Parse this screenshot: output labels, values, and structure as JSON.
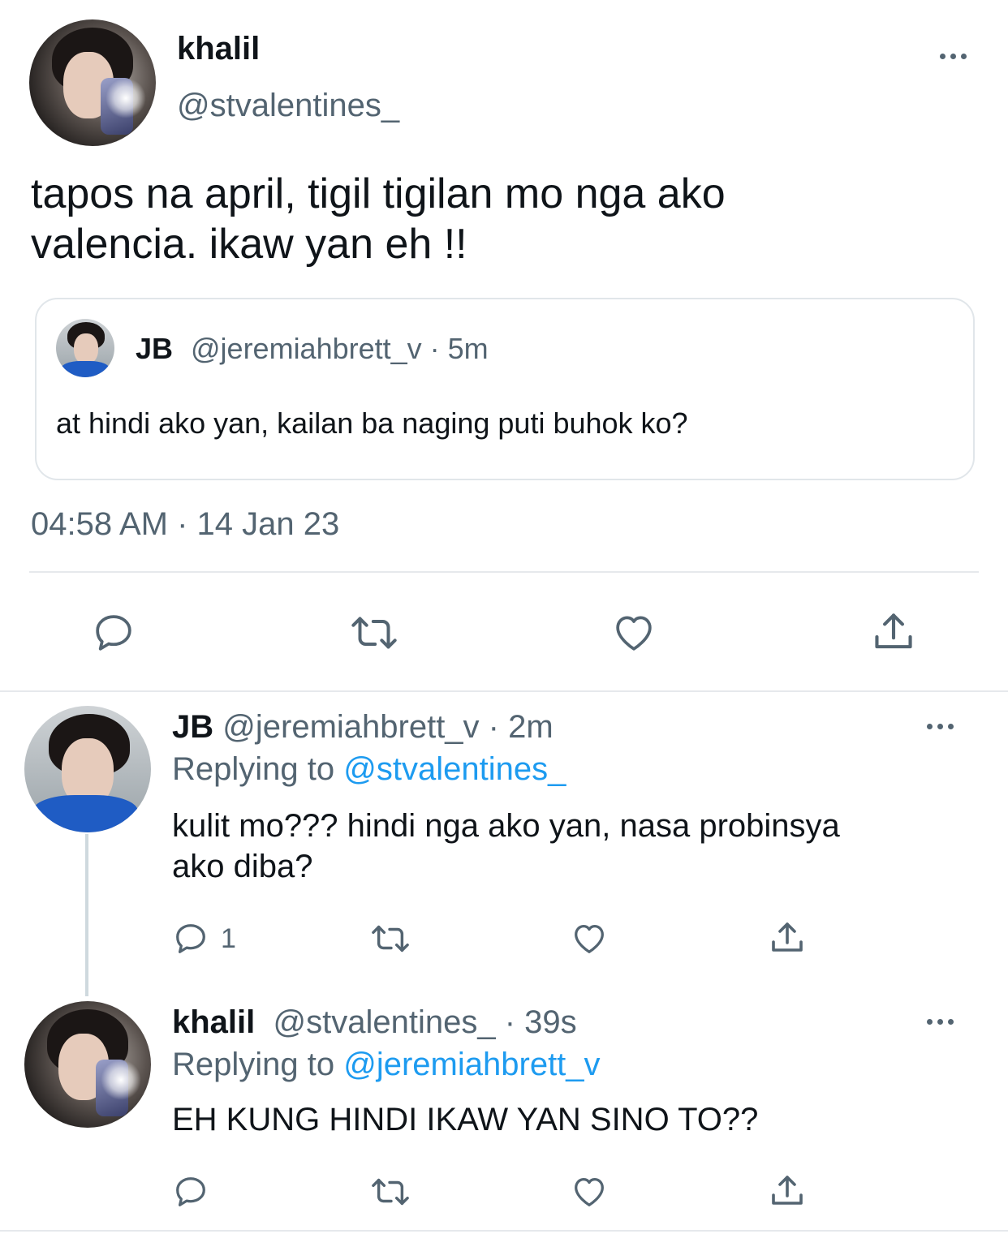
{
  "main_tweet": {
    "display_name": "khalil",
    "handle": "@stvalentines_",
    "text_line1": "tapos na april, tigil tigilan mo nga ako",
    "text_line2": "valencia. ikaw yan eh !!",
    "timestamp": "04:58 AM · 14 Jan 23",
    "quoted": {
      "display_name": "JB",
      "handle_time": "@jeremiahbrett_v · 5m",
      "text": "at hindi ako yan, kailan ba naging puti buhok ko?"
    }
  },
  "replies": [
    {
      "display_name": "JB",
      "handle_time": "@jeremiahbrett_v · 2m",
      "replying_prefix": "Replying to",
      "replying_to": "@stvalentines_",
      "text_line1": "kulit mo??? hindi nga ako yan, nasa probinsya",
      "text_line2": "ako diba?",
      "reply_count": "1"
    },
    {
      "display_name": "khalil",
      "handle_time": "@stvalentines_ · 39s",
      "replying_prefix": "Replying to",
      "replying_to": "@jeremiahbrett_v",
      "text_line1": "EH KUNG HINDI IKAW YAN SINO TO??"
    }
  ],
  "icons": [
    "reply-icon",
    "retweet-icon",
    "like-icon",
    "share-icon",
    "more-icon"
  ],
  "colors": {
    "text": "#0f1419",
    "secondary": "#536471",
    "link": "#1d9bf0",
    "divider": "#e6e9ec"
  }
}
